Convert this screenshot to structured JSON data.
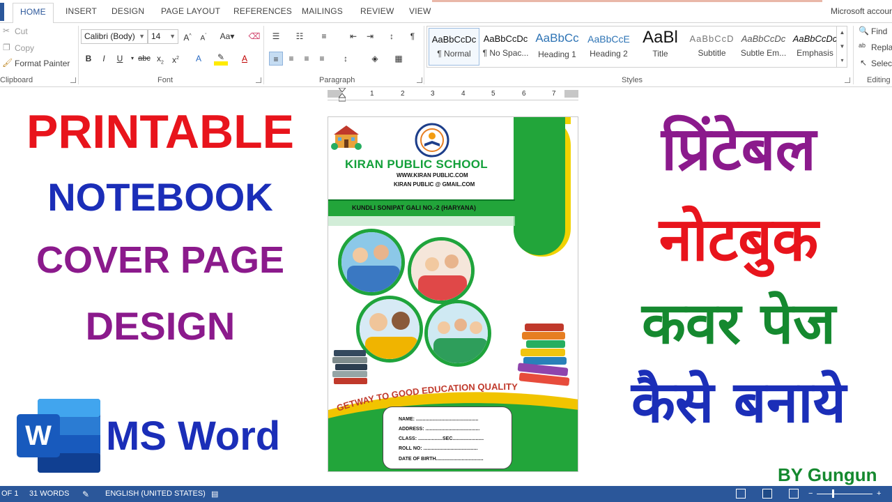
{
  "ribbon": {
    "tabs": [
      "HOME",
      "INSERT",
      "DESIGN",
      "PAGE LAYOUT",
      "REFERENCES",
      "MAILINGS",
      "REVIEW",
      "VIEW"
    ],
    "account": "Microsoft accour",
    "clipboard": {
      "cut": "Cut",
      "copy": "Copy",
      "format_painter": "Format Painter",
      "label": "Clipboard"
    },
    "font": {
      "name": "Calibri (Body)",
      "size": "14",
      "label": "Font"
    },
    "paragraph": {
      "label": "Paragraph"
    },
    "styles": {
      "label": "Styles",
      "items": [
        {
          "preview": "AaBbCcDc",
          "name": "¶ Normal"
        },
        {
          "preview": "AaBbCcDc",
          "name": "¶ No Spac..."
        },
        {
          "preview": "AaBbCc",
          "name": "Heading 1"
        },
        {
          "preview": "AaBbCcE",
          "name": "Heading 2"
        },
        {
          "preview": "AaBl",
          "name": "Title"
        },
        {
          "preview": "AaBbCcD",
          "name": "Subtitle"
        },
        {
          "preview": "AaBbCcDc",
          "name": "Subtle Em..."
        },
        {
          "preview": "AaBbCcDc",
          "name": "Emphasis"
        }
      ]
    },
    "editing": {
      "find": "Find",
      "replace": "Replac",
      "select": "Selec",
      "label": "Editing"
    }
  },
  "ruler": {
    "numbers": [
      "1",
      "2",
      "3",
      "4",
      "5",
      "6",
      "7"
    ]
  },
  "overlay": {
    "english_lines": [
      "PRINTABLE",
      "NOTEBOOK",
      "COVER PAGE",
      "DESIGN"
    ],
    "english_colors": [
      "#e8141c",
      "#1b2eb8",
      "#8b1a8c",
      "#8b1a8c"
    ],
    "hindi_lines": [
      "प्रिंटेबल",
      "नोटबुक",
      "कवर पेज",
      "कैसे बनाये"
    ],
    "hindi_colors": [
      "#8b1a8c",
      "#e8141c",
      "#15892f",
      "#1b2eb8"
    ],
    "ms_word": "MS Word",
    "byline": "BY Gungun"
  },
  "cover": {
    "school_name": "KIRAN PUBLIC SCHOOL",
    "website": "WWW.KIRAN PUBLIC.COM",
    "email": "KIRAN PUBLIC @ GMAIL.COM",
    "address": "KUNDLI SONIPAT GALI NO.-2 (HARYANA)",
    "slogan": "GETWAY TO GOOD EDUCATION QUALITY",
    "fields": [
      "NAME: ..............................................",
      "ADDRESS: ........................................",
      "CLASS: ..................SEC.......................",
      "ROLL NO: ........................................",
      "DATE OF BIRTH..................................."
    ]
  },
  "status": {
    "page": "OF 1",
    "words": "31 WORDS",
    "language": "ENGLISH (UNITED STATES)"
  }
}
